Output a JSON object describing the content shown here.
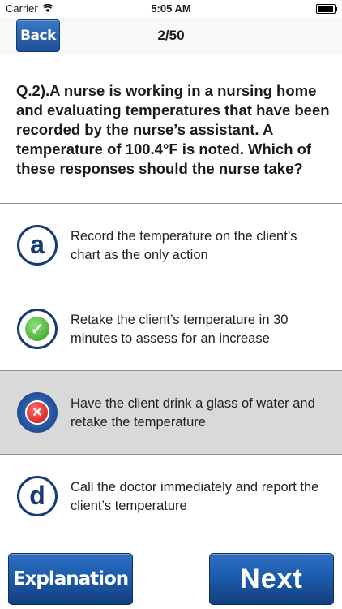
{
  "status": {
    "carrier": "Carrier",
    "time": "5:05 AM"
  },
  "nav": {
    "back_label": "Back",
    "counter": "2/50"
  },
  "question": {
    "text": "Q.2).A nurse is working in a nursing home and evaluating temperatures that have been recorded by the nurse’s assistant. A temperature of 100.4°F is noted. Which of these responses should the nurse take?"
  },
  "options": [
    {
      "letter": "a",
      "text": "Record the temperature on the client’s chart as the only action",
      "state": "normal",
      "icon": "letter-a-icon"
    },
    {
      "letter": "b",
      "text": "Retake the client’s temperature in 30 minutes to assess for an increase",
      "state": "correct",
      "icon": "check-icon"
    },
    {
      "letter": "c",
      "text": "Have the client drink a glass of water and retake the temperature",
      "state": "wrong",
      "icon": "x-icon"
    },
    {
      "letter": "d",
      "text": "Call the doctor immediately and report the client’s temperature",
      "state": "normal",
      "icon": "letter-d-icon"
    }
  ],
  "icons": {
    "check": "✓",
    "cross": "✕"
  },
  "footer": {
    "explanation_label": "Explanation",
    "next_label": "Next"
  },
  "colors": {
    "button_blue": "#1b5aa9",
    "icon_navy": "#173a73",
    "correct_green": "#2f9e1f",
    "wrong_red": "#c90d0d",
    "selected_bg": "#d9d9d9"
  }
}
